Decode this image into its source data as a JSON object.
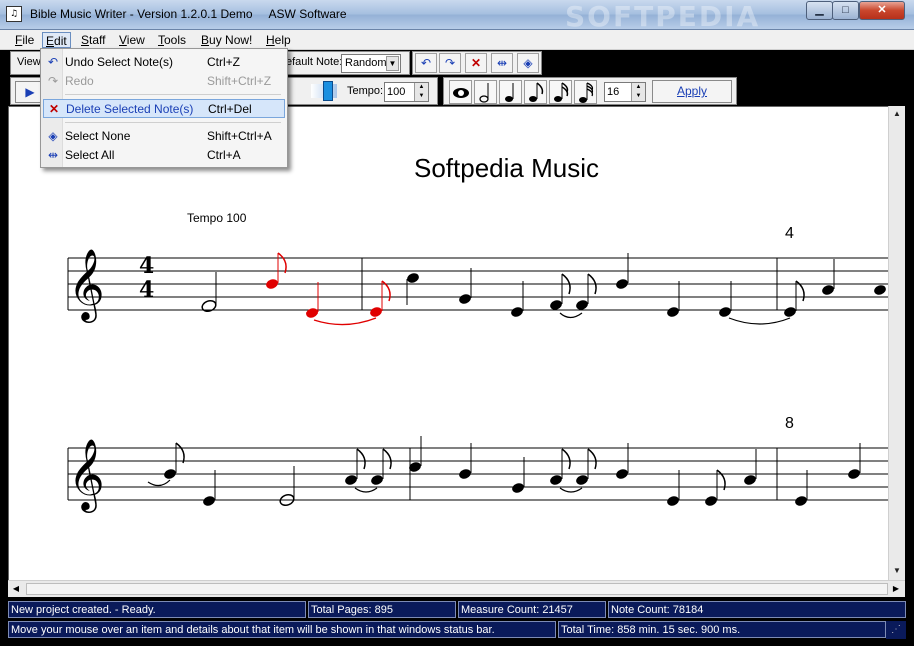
{
  "window": {
    "title": "Bible Music Writer - Version 1.2.0.1 Demo     ASW Software",
    "app_icon_text": "♫",
    "watermark": "SOFTPEDIA",
    "minimize": "▁",
    "maximize": "□",
    "close": "✕"
  },
  "menubar": {
    "items": [
      {
        "label": "File",
        "underline": "F"
      },
      {
        "label": "Edit",
        "underline": "E"
      },
      {
        "label": "Staff",
        "underline": "S"
      },
      {
        "label": "View",
        "underline": "V"
      },
      {
        "label": "Tools",
        "underline": "T"
      },
      {
        "label": "Buy Now!",
        "underline": "B"
      },
      {
        "label": "Help",
        "underline": "H"
      }
    ]
  },
  "toolbar": {
    "view_label": "View",
    "default_note_label": "efault Note:",
    "default_note_value": "Random",
    "tempo_label": "Tempo:",
    "tempo_value": "100",
    "note_count_value": "16",
    "apply_label": "Apply",
    "icons": [
      "undo-icon",
      "redo-icon",
      "delete-icon",
      "select-all-icon",
      "select-none-icon"
    ]
  },
  "edit_menu": {
    "items": [
      {
        "label": "Undo Select Note(s)",
        "shortcut": "Ctrl+Z",
        "icon": "undo-icon",
        "enabled": true
      },
      {
        "label": "Redo",
        "shortcut": "Shift+Ctrl+Z",
        "icon": "redo-icon",
        "enabled": false
      },
      {
        "label": "Delete Selected Note(s)",
        "shortcut": "Ctrl+Del",
        "icon": "delete-icon",
        "enabled": true,
        "highlighted": true
      },
      {
        "label": "Select None",
        "shortcut": "Shift+Ctrl+A",
        "icon": "select-none-icon",
        "enabled": true
      },
      {
        "label": "Select All",
        "shortcut": "Ctrl+A",
        "icon": "select-all-icon",
        "enabled": true
      }
    ]
  },
  "score": {
    "title": "Softpedia Music",
    "tempo_label": "Tempo 100",
    "time_signature": {
      "top": "4",
      "bottom": "4"
    },
    "measure_numbers": [
      "4",
      "8"
    ],
    "selected_color": "#e00000",
    "note_color": "#000000"
  },
  "status": {
    "message": "New project created. - Ready.",
    "total_pages": "Total Pages: 895",
    "measure_count": "Measure Count: 21457",
    "note_count": "Note Count: 78184",
    "hint": "Move your mouse over an item and details about that item will be shown in that windows status bar.",
    "total_time": "Total Time: 858 min. 15 sec. 900 ms."
  },
  "colors": {
    "status_bg": "#0a1a5a",
    "accent_blue": "#1a3fb5",
    "delete_red": "#c00000"
  }
}
